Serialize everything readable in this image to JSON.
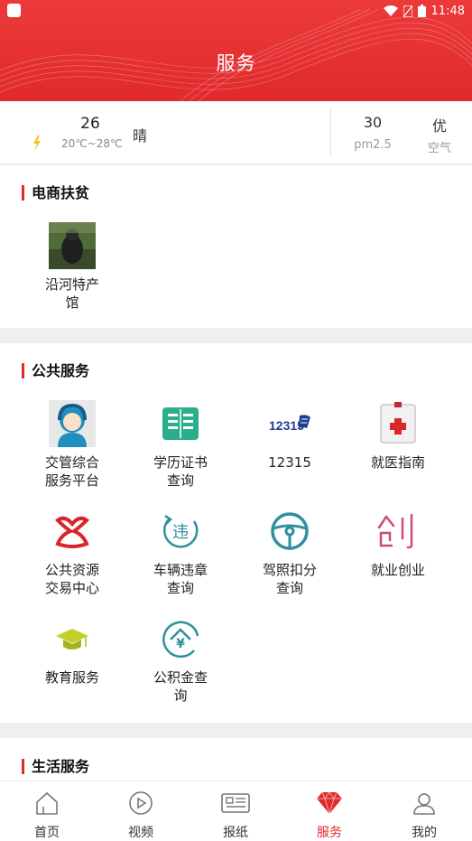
{
  "status_bar": {
    "time": "11:48"
  },
  "header": {
    "title": "服务"
  },
  "weather": {
    "temperature": "26",
    "temp_range": "20℃~28℃",
    "condition": "晴",
    "aqi_value": "30",
    "aqi_label": "pm2.5",
    "air_quality": "优",
    "air_label": "空气"
  },
  "sections": {
    "ecommerce": {
      "title": "电商扶贫",
      "items": [
        {
          "line1": "沿河特产",
          "line2": "馆",
          "icon": "specialty-store-photo"
        }
      ]
    },
    "public": {
      "title": "公共服务",
      "items": [
        {
          "line1": "交管综合",
          "line2": "服务平台",
          "icon": "customer-service-icon"
        },
        {
          "line1": "学历证书",
          "line2": "查询",
          "icon": "certificate-book-icon"
        },
        {
          "line1": "12315",
          "line2": "",
          "icon": "12315-logo-icon"
        },
        {
          "line1": "就医指南",
          "line2": "",
          "icon": "medical-kit-icon"
        },
        {
          "line1": "公共资源",
          "line2": "交易中心",
          "icon": "trading-center-logo-icon"
        },
        {
          "line1": "车辆违章",
          "line2": "查询",
          "icon": "violation-icon"
        },
        {
          "line1": "驾照扣分",
          "line2": "查询",
          "icon": "steering-wheel-icon"
        },
        {
          "line1": "就业创业",
          "line2": "",
          "icon": "entrepreneurship-icon"
        },
        {
          "line1": "教育服务",
          "line2": "",
          "icon": "graduation-cap-icon"
        },
        {
          "line1": "公积金查",
          "line2": "询",
          "icon": "housing-fund-icon"
        }
      ]
    },
    "life": {
      "title": "生活服务"
    }
  },
  "tabbar": {
    "active": "服务",
    "tabs": [
      {
        "label": "首页",
        "icon": "home-icon"
      },
      {
        "label": "视频",
        "icon": "video-play-icon"
      },
      {
        "label": "报纸",
        "icon": "newspaper-icon"
      },
      {
        "label": "服务",
        "icon": "diamond-icon"
      },
      {
        "label": "我的",
        "icon": "user-icon"
      }
    ]
  },
  "colors": {
    "brand_red": "#e02a2c",
    "teal": "#2f8f9d",
    "green": "#2bae8a",
    "pink": "#d0487f"
  }
}
